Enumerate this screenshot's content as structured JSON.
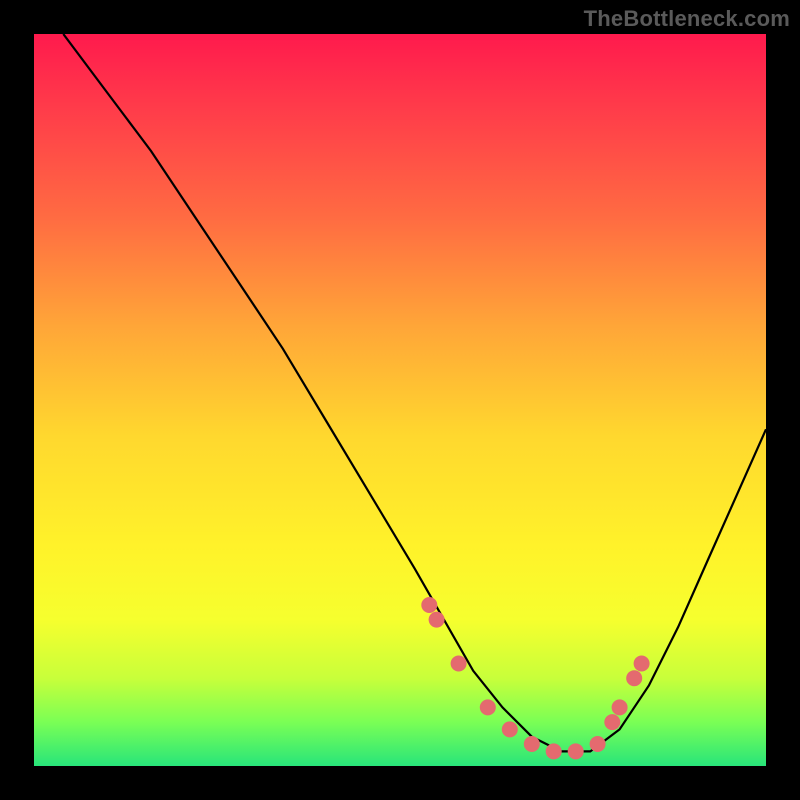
{
  "watermark": "TheBottleneck.com",
  "chart_data": {
    "type": "line",
    "title": "",
    "xlabel": "",
    "ylabel": "",
    "xlim": [
      0,
      100
    ],
    "ylim": [
      0,
      100
    ],
    "series": [
      {
        "name": "bottleneck-curve",
        "x": [
          4,
          10,
          16,
          22,
          28,
          34,
          40,
          46,
          52,
          56,
          60,
          64,
          68,
          72,
          76,
          80,
          84,
          88,
          92,
          96,
          100
        ],
        "y": [
          100,
          92,
          84,
          75,
          66,
          57,
          47,
          37,
          27,
          20,
          13,
          8,
          4,
          2,
          2,
          5,
          11,
          19,
          28,
          37,
          46
        ]
      }
    ],
    "markers": {
      "name": "highlight-points",
      "x": [
        54,
        55,
        58,
        62,
        65,
        68,
        71,
        74,
        77,
        79,
        80,
        82,
        83
      ],
      "y": [
        22,
        20,
        14,
        8,
        5,
        3,
        2,
        2,
        3,
        6,
        8,
        12,
        14
      ]
    },
    "colors": {
      "curve": "#000000",
      "marker": "#e46a6f"
    }
  }
}
